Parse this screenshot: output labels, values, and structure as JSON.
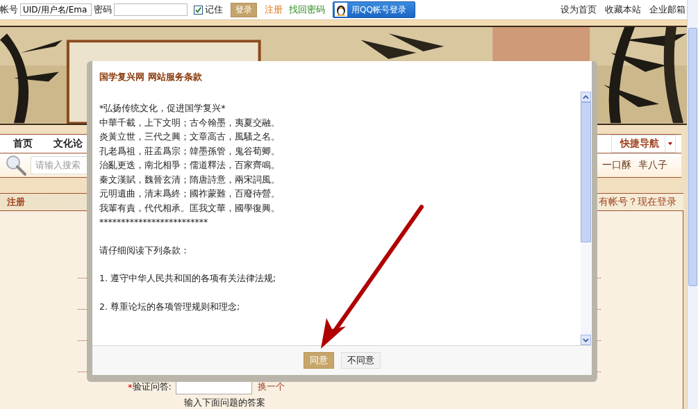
{
  "top_bar": {
    "account_label": "帐号",
    "account_value": "UID/用户名/Ema",
    "password_label": "密码",
    "remember": {
      "label": "记住",
      "checked": true
    },
    "login_button": "登录",
    "register_link": "注册",
    "recover_link": "找回密码",
    "qq_button": "用QQ帐号登录",
    "links": [
      "设为首页",
      "收藏本站",
      "企业邮箱"
    ]
  },
  "nav": {
    "items": [
      "首页",
      "文化论"
    ],
    "quick_nav": "快捷导航"
  },
  "search": {
    "placeholder": "请输入搜索",
    "hot_words": [
      "一口酥",
      "芈八子"
    ]
  },
  "register_panel": {
    "title": "注册",
    "login_link": "有帐号？现在登录",
    "question": {
      "required_mark": "*",
      "label": "验证问答:",
      "change_link": "换一个",
      "hint": "输入下面问题的答案"
    }
  },
  "dialog": {
    "title": "国学复兴网 网站服务条款",
    "paragraphs": [
      [
        "*弘扬传统文化，促进国学复兴*",
        "中華千載，上下文明；古今翰墨，夷夏交融。",
        "炎黃立世，三代之興；文章高古，風騷之名。",
        "孔老爲祖，莊孟爲宗；韓墨孫管，鬼谷荀卿。",
        "治亂更迭，南北相爭；儒道釋法，百家齊鳴。",
        "秦文漢賦，魏晉玄清；隋唐詩意，兩宋詞風。",
        "元明遺曲，清末爲終；國祚蒙難，百廢待營。",
        "我輩有責，代代相承。匡我文華，國學復興。",
        "*************************"
      ],
      [
        "请仔细阅读下列条款："
      ],
      [
        "1. 遵守中华人民共和国的各项有关法律法规;"
      ],
      [
        "2. 尊重论坛的各项管理规则和理念;"
      ]
    ],
    "buttons": [
      {
        "label": "同意",
        "primary": true
      },
      {
        "label": "不同意",
        "primary": false
      }
    ]
  }
}
